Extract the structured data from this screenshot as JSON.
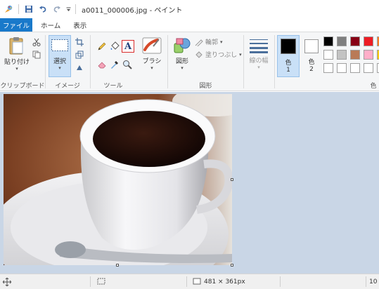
{
  "window": {
    "title": "a0011_000006.jpg - ペイント"
  },
  "tabs": [
    {
      "label": "ファイル"
    },
    {
      "label": "ホーム"
    },
    {
      "label": "表示"
    }
  ],
  "ribbon": {
    "clipboard": {
      "paste_label": "貼り付け",
      "group_label": "クリップボード"
    },
    "image": {
      "select_label": "選択",
      "group_label": "イメージ"
    },
    "tools": {
      "group_label": "ツール"
    },
    "brushes": {
      "label": "ブラシ"
    },
    "shapes": {
      "shapes_label": "図形",
      "outline_label": "輪郭",
      "fill_label": "塗りつぶし",
      "group_label": "図形"
    },
    "size": {
      "label": "線の幅"
    },
    "colors": {
      "color1_line1": "色",
      "color1_line2": "1",
      "color2_line1": "色",
      "color2_line2": "2",
      "group_label": "色",
      "color1_value": "#000000",
      "color2_value": "#ffffff",
      "palette_row1": [
        "#000000",
        "#7f7f7f",
        "#880015",
        "#ed1c24",
        "#ff7f27"
      ],
      "palette_row2": [
        "#ffffff",
        "#c3c3c3",
        "#b97a57",
        "#ffaec9",
        "#ffc90e"
      ],
      "palette_row3": [
        "#ffffff",
        "#ffffff",
        "#ffffff",
        "#ffffff",
        "#ffffff"
      ]
    }
  },
  "status": {
    "dimensions": "481 × 361px",
    "zoom": "10"
  }
}
